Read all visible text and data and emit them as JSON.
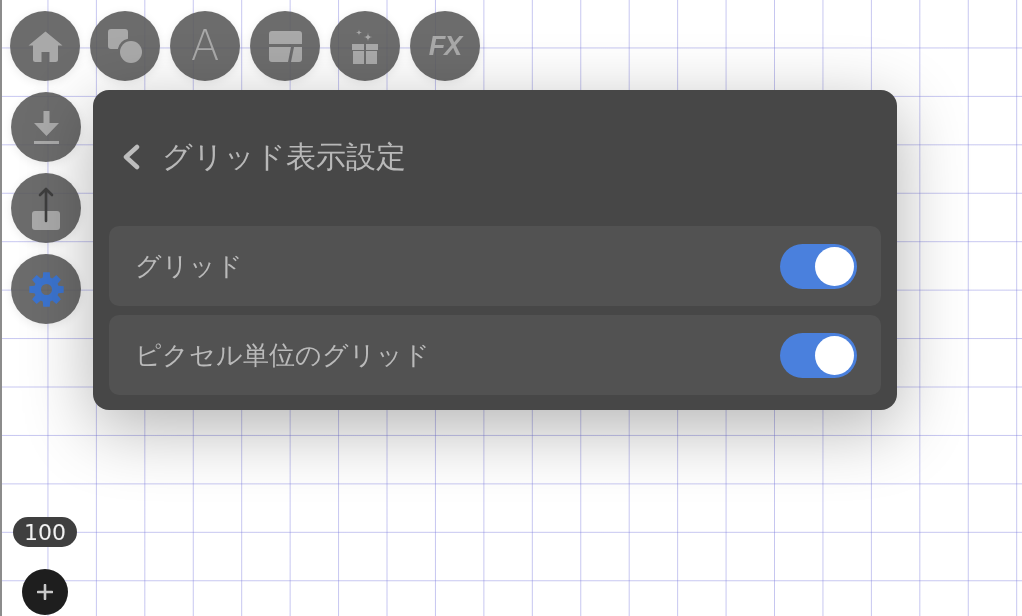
{
  "top_toolbar": [
    {
      "kind": "home",
      "selected": false
    },
    {
      "kind": "shapes",
      "selected": false
    },
    {
      "kind": "text",
      "label": "A",
      "selected": false
    },
    {
      "kind": "layout",
      "selected": false
    },
    {
      "kind": "gift",
      "selected": false
    },
    {
      "kind": "effects",
      "label": "FX",
      "selected": false
    }
  ],
  "side_toolbar": [
    {
      "kind": "download",
      "selected": false
    },
    {
      "kind": "share",
      "selected": false
    },
    {
      "kind": "settings",
      "selected": true
    }
  ],
  "panel": {
    "title": "グリッド表示設定",
    "rows": [
      {
        "label": "グリッド",
        "on": true
      },
      {
        "label": "ピクセル単位のグリッド",
        "on": true
      }
    ]
  },
  "zoom_level": "100"
}
